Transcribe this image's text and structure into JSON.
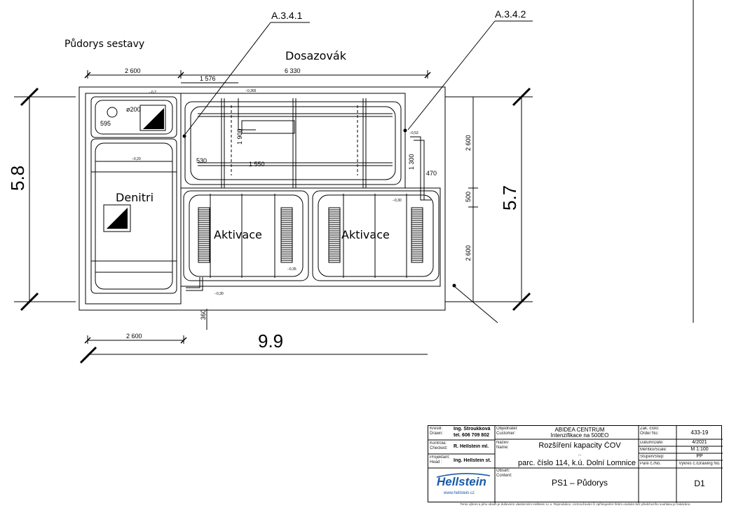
{
  "drawing": {
    "subtitle": "Půdorys sestavy",
    "dosazovak": "Dosazovák",
    "denitri": "Denitri",
    "aktivace_1": "Aktivace",
    "aktivace_2": "Aktivace",
    "ref_1": "A.3.4.1",
    "ref_2": "A.3.4.2",
    "overall_left": "5.8",
    "overall_right": "5.7",
    "overall_bottom": "9.9",
    "dims": {
      "top_left": "2 600",
      "top_right": "6 330",
      "top_mid": "1 576",
      "bottom": "2 600",
      "right_top": "2 600",
      "right_mid": "500",
      "right_bottom": "2 600",
      "d_1900": "1 900",
      "d_1300": "1 300",
      "d_1550": "1 550",
      "d_470": "470",
      "d_530": "530",
      "d_595": "595",
      "d_360": "360",
      "d_200": "ø200"
    },
    "level_marks": [
      "−0,2",
      "−0,365",
      "−0,53",
      "−0,20",
      "−0,30",
      "−0,35",
      "−0,30"
    ]
  },
  "title_block": {
    "drawn_label": "Kreslil:\nDrawn:",
    "drawn_name": "Ing. Stroukková",
    "drawn_tel": "tel. 606 709 802",
    "checked_label": "Kontrola:\nChecked:",
    "checked_name": "R. Hellstein ml.",
    "head_label": "Projektant:\nHead :",
    "head_name": "Ing. Hellstein st.",
    "objednatel_label": "Objednatel:\nCustomer:",
    "objednatel_value": "ABIDEA CENTRUM",
    "objednatel_value2": "Intenzifikace na 500EO",
    "nazev_label": "Název:\nName:",
    "nazev_value": "Rozšíření kapacity ČOV",
    "nazev_value2": "..",
    "location_value": "parc. číslo 114,  k.ú. Dolní Lomnice",
    "obsah_label": "Obsah:\nContent:",
    "obsah_value": "PS1 – Půdorys",
    "order_label": "Zak. číslo:\nOrder No:",
    "order_value": "433-19",
    "date_label": "Datum/Date:",
    "date_value": "4/2021",
    "scale_label": "Měřítko/Scale:",
    "scale_value": "M  1:100",
    "stage_label": "Stupeň/Step:",
    "stage_value": "PP",
    "copy_label": "Paré č./No.",
    "drawing_no_label": "Výkres č./Drawing No.",
    "drawing_no_value": "D1",
    "company": "Hellstein",
    "website": "www.hellstein.cz",
    "footer": "Tento výkres a jeho obsah je duševním vlastnictvím Hellstein s.r.o. Reprodukce, rozmnožování či zpřístupnění třetím osobám bez předchozího souhlasu je zakázáno."
  },
  "colors": {
    "line": "#000000",
    "background": "#ffffff",
    "logo": "#1a5aa8"
  }
}
